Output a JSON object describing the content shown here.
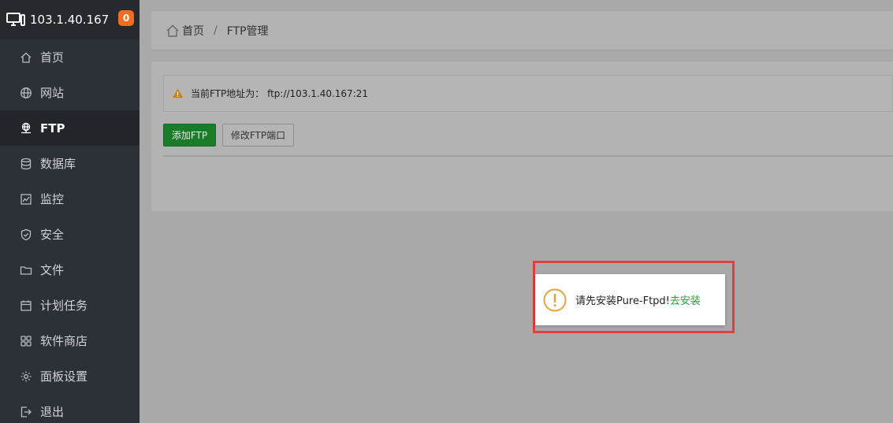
{
  "sidebar": {
    "host": "103.1.40.167",
    "badge": "0",
    "items": [
      {
        "label": "首页",
        "icon": "home-icon"
      },
      {
        "label": "网站",
        "icon": "globe-icon"
      },
      {
        "label": "FTP",
        "icon": "ftp-icon",
        "active": true
      },
      {
        "label": "数据库",
        "icon": "database-icon"
      },
      {
        "label": "监控",
        "icon": "monitor-icon"
      },
      {
        "label": "安全",
        "icon": "shield-icon"
      },
      {
        "label": "文件",
        "icon": "folder-icon"
      },
      {
        "label": "计划任务",
        "icon": "calendar-icon"
      },
      {
        "label": "软件商店",
        "icon": "grid-icon"
      },
      {
        "label": "面板设置",
        "icon": "gear-icon"
      },
      {
        "label": "退出",
        "icon": "logout-icon"
      }
    ]
  },
  "breadcrumb": {
    "home": "首页",
    "separator": "/",
    "current": "FTP管理"
  },
  "alert": {
    "text": "当前FTP地址为： ftp://103.1.40.167:21"
  },
  "toolbar": {
    "add_label": "添加FTP",
    "port_label": "修改FTP端口"
  },
  "toast": {
    "message": "请先安装Pure-Ftpd!",
    "link": "去安装"
  },
  "colors": {
    "sidebar_bg": "#2c3137",
    "badge": "#f36c20",
    "primary_button": "#1a7c28",
    "link": "#20a53a",
    "highlight_border": "#e0403f",
    "warning": "#e6a23c"
  }
}
